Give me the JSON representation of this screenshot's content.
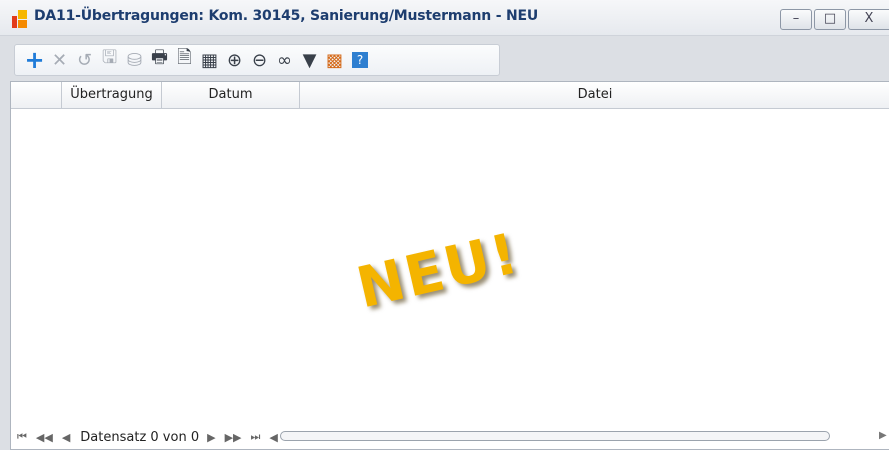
{
  "window": {
    "title": "DA11-Übertragungen: Kom. 30145, Sanierung/Mustermann - NEU",
    "controls": {
      "minimize": "–",
      "maximize": "□",
      "close": "X"
    }
  },
  "toolbar": {
    "items": [
      {
        "name": "add-button",
        "icon": "plus-icon",
        "glyph": "+"
      },
      {
        "name": "delete-button",
        "icon": "close-icon",
        "glyph": "✕"
      },
      {
        "name": "undo-button",
        "icon": "undo-icon",
        "glyph": "↺"
      },
      {
        "name": "save-button",
        "icon": "save-icon",
        "glyph": "🖫"
      },
      {
        "name": "save-close-button",
        "icon": "save-close-icon",
        "glyph": "⛁"
      },
      {
        "name": "print-button",
        "icon": "printer-icon",
        "glyph": "🖶"
      },
      {
        "name": "print-preview-button",
        "icon": "print-preview-icon",
        "glyph": "🗎"
      },
      {
        "name": "columns-button",
        "icon": "columns-icon",
        "glyph": "▦"
      },
      {
        "name": "zoom-in-button",
        "icon": "zoom-in-icon",
        "glyph": "⊕"
      },
      {
        "name": "zoom-out-button",
        "icon": "zoom-out-icon",
        "glyph": "⊖"
      },
      {
        "name": "search-button",
        "icon": "binoculars-icon",
        "glyph": "∞"
      },
      {
        "name": "filter-button",
        "icon": "filter-icon",
        "glyph": "▼"
      },
      {
        "name": "layout-button",
        "icon": "grid-settings-icon",
        "glyph": "▩"
      },
      {
        "name": "help-button",
        "icon": "help-icon",
        "glyph": "?"
      }
    ]
  },
  "grid": {
    "columns": [
      "Übertragung",
      "Datum",
      "Datei"
    ],
    "rows": []
  },
  "watermark": "NEU!",
  "navigator": {
    "first": "⏮",
    "prev_page": "◀◀",
    "prev": "◀",
    "record_text": "Datensatz 0 von 0",
    "next": "▶",
    "next_page": "▶▶",
    "last": "⏭",
    "scroll_left": "◀",
    "scroll_right": "▶"
  }
}
